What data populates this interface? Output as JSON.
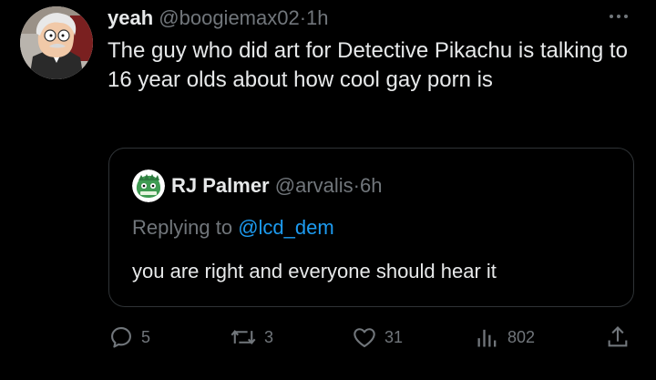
{
  "tweet": {
    "display_name": "yeah",
    "handle": "@boogiemax02",
    "separator": "·",
    "time": "1h",
    "text": "The guy who did art for Detective Pikachu is talking to 16 year olds about how cool gay porn is"
  },
  "quote": {
    "display_name": "RJ Palmer",
    "handle": "@arvalis",
    "separator": "·",
    "time": "6h",
    "replying_prefix": "Replying to",
    "replying_to": "@lcd_dem",
    "text": "you are right and everyone should hear it"
  },
  "actions": {
    "replies": "5",
    "reposts": "3",
    "likes": "31",
    "views": "802"
  },
  "icons": {
    "more": "more-horizontal-icon",
    "reply": "reply-icon",
    "repost": "repost-icon",
    "like": "heart-icon",
    "views": "views-icon",
    "share": "share-icon"
  },
  "colors": {
    "background": "#000000",
    "text": "#e7e9ea",
    "muted": "#71767b",
    "link": "#1d9bf0",
    "border": "#2f3336"
  }
}
